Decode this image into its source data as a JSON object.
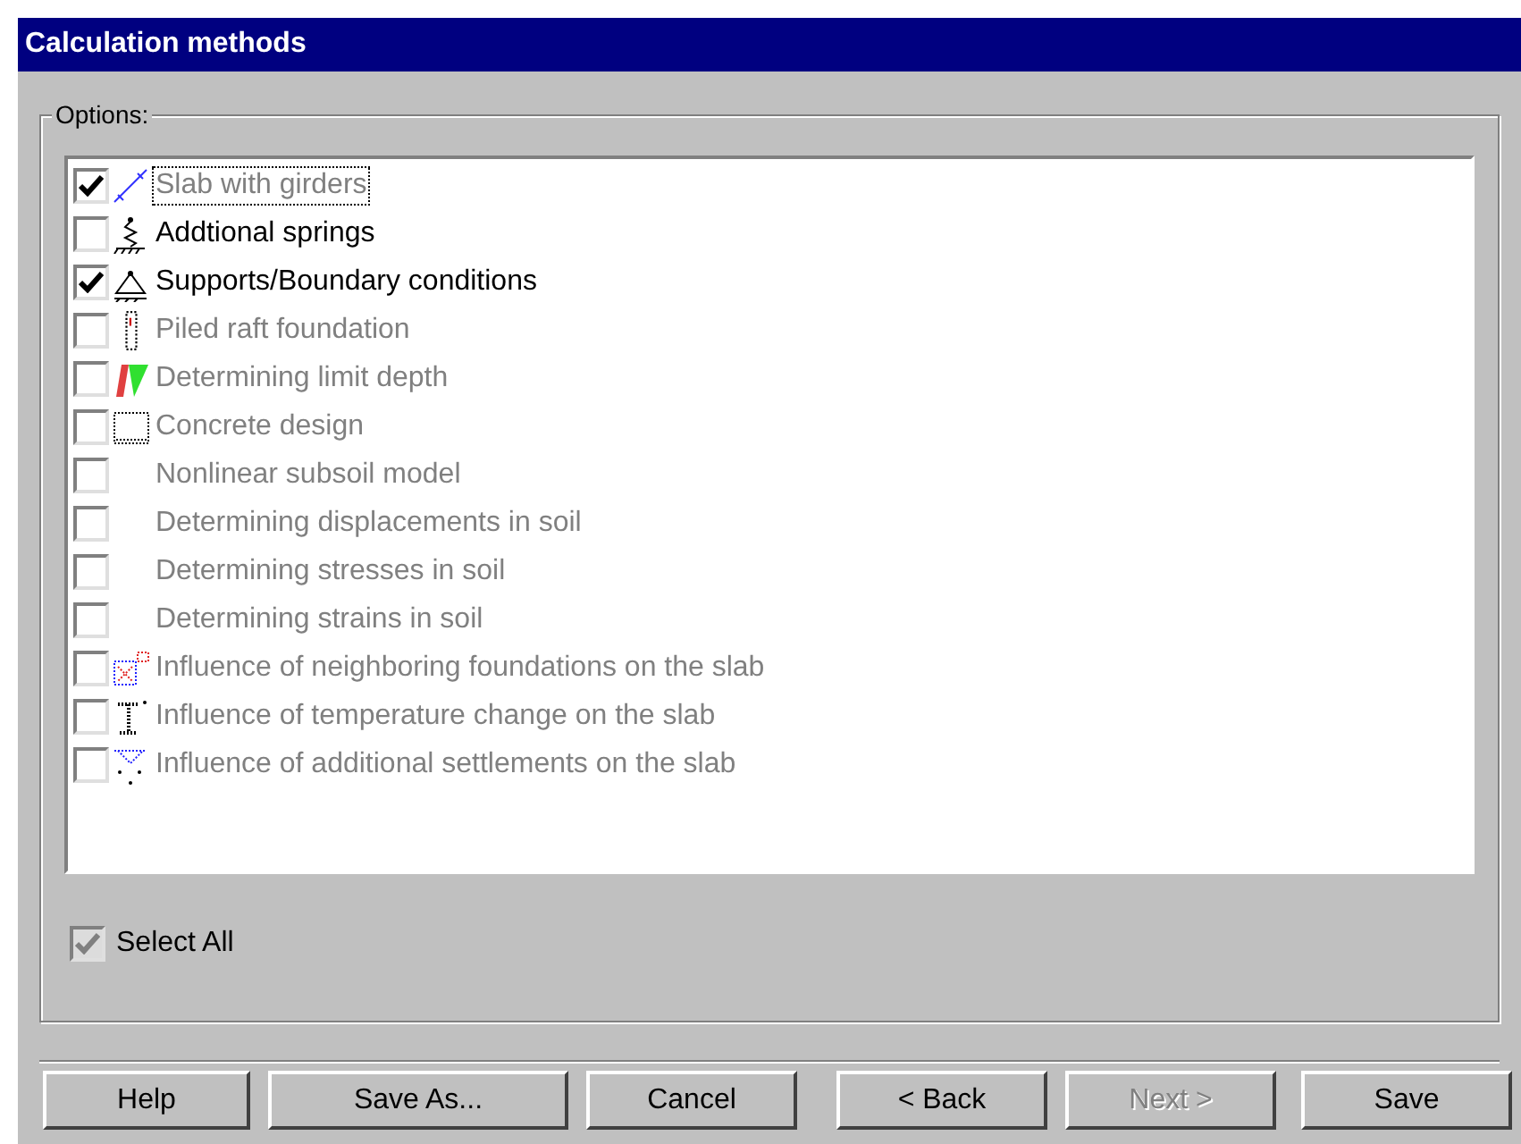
{
  "window": {
    "title": "Calculation methods"
  },
  "options": {
    "label": "Options:",
    "items": [
      {
        "label": "Slab with girders",
        "checked": true,
        "disabled": true,
        "focused": true,
        "kind": "girder"
      },
      {
        "label": "Addtional springs",
        "checked": false,
        "disabled": false,
        "focused": false,
        "kind": "spring"
      },
      {
        "label": "Supports/Boundary conditions",
        "checked": true,
        "disabled": false,
        "focused": false,
        "kind": "support"
      },
      {
        "label": "Piled raft foundation",
        "checked": false,
        "disabled": true,
        "focused": false,
        "kind": "pile"
      },
      {
        "label": "Determining limit depth",
        "checked": false,
        "disabled": true,
        "focused": false,
        "kind": "depth"
      },
      {
        "label": "Concrete design",
        "checked": false,
        "disabled": true,
        "focused": false,
        "kind": "concrete"
      },
      {
        "label": "Nonlinear subsoil model",
        "checked": false,
        "disabled": true,
        "focused": false,
        "kind": "plain"
      },
      {
        "label": "Determining displacements in soil",
        "checked": false,
        "disabled": true,
        "focused": false,
        "kind": "plain"
      },
      {
        "label": "Determining stresses in soil",
        "checked": false,
        "disabled": true,
        "focused": false,
        "kind": "plain"
      },
      {
        "label": "Determining strains in soil",
        "checked": false,
        "disabled": true,
        "focused": false,
        "kind": "plain"
      },
      {
        "label": "Influence of neighboring foundations on the slab",
        "checked": false,
        "disabled": true,
        "focused": false,
        "kind": "neighbor"
      },
      {
        "label": "Influence of temperature change on the slab",
        "checked": false,
        "disabled": true,
        "focused": false,
        "kind": "temperature"
      },
      {
        "label": "Influence of additional settlements on the slab",
        "checked": false,
        "disabled": true,
        "focused": false,
        "kind": "settlement"
      }
    ],
    "select_all": {
      "label": "Select All",
      "checked": true,
      "disabled": true
    }
  },
  "buttons": [
    {
      "label": "Help",
      "disabled": false
    },
    {
      "label": "Save As...",
      "disabled": false
    },
    {
      "label": "Cancel",
      "disabled": false
    },
    {
      "label": "< Back",
      "disabled": false
    },
    {
      "label": "Next >",
      "disabled": true
    },
    {
      "label": "Save",
      "disabled": false
    }
  ]
}
